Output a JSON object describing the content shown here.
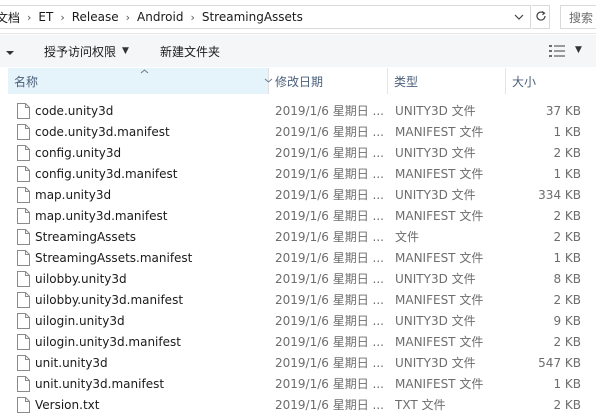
{
  "address_bar": {
    "crumbs": [
      "文档",
      "ET",
      "Release",
      "Android",
      "StreamingAssets"
    ],
    "separator": "›"
  },
  "search": {
    "placeholder": "搜索"
  },
  "toolbar": {
    "share_label": "授予访问权限",
    "new_folder_label": "新建文件夹"
  },
  "columns": {
    "name": "名称",
    "date": "修改日期",
    "type": "类型",
    "size": "大小"
  },
  "files": [
    {
      "name": "code.unity3d",
      "date": "2019/1/6 星期日 ...",
      "type": "UNITY3D 文件",
      "size": "37 KB"
    },
    {
      "name": "code.unity3d.manifest",
      "date": "2019/1/6 星期日 ...",
      "type": "MANIFEST 文件",
      "size": "1 KB"
    },
    {
      "name": "config.unity3d",
      "date": "2019/1/6 星期日 ...",
      "type": "UNITY3D 文件",
      "size": "2 KB"
    },
    {
      "name": "config.unity3d.manifest",
      "date": "2019/1/6 星期日 ...",
      "type": "MANIFEST 文件",
      "size": "1 KB"
    },
    {
      "name": "map.unity3d",
      "date": "2019/1/6 星期日 ...",
      "type": "UNITY3D 文件",
      "size": "334 KB"
    },
    {
      "name": "map.unity3d.manifest",
      "date": "2019/1/6 星期日 ...",
      "type": "MANIFEST 文件",
      "size": "2 KB"
    },
    {
      "name": "StreamingAssets",
      "date": "2019/1/6 星期日 ...",
      "type": "文件",
      "size": "2 KB"
    },
    {
      "name": "StreamingAssets.manifest",
      "date": "2019/1/6 星期日 ...",
      "type": "MANIFEST 文件",
      "size": "1 KB"
    },
    {
      "name": "uilobby.unity3d",
      "date": "2019/1/6 星期日 ...",
      "type": "UNITY3D 文件",
      "size": "8 KB"
    },
    {
      "name": "uilobby.unity3d.manifest",
      "date": "2019/1/6 星期日 ...",
      "type": "MANIFEST 文件",
      "size": "2 KB"
    },
    {
      "name": "uilogin.unity3d",
      "date": "2019/1/6 星期日 ...",
      "type": "UNITY3D 文件",
      "size": "9 KB"
    },
    {
      "name": "uilogin.unity3d.manifest",
      "date": "2019/1/6 星期日 ...",
      "type": "MANIFEST 文件",
      "size": "2 KB"
    },
    {
      "name": "unit.unity3d",
      "date": "2019/1/6 星期日 ...",
      "type": "UNITY3D 文件",
      "size": "547 KB"
    },
    {
      "name": "unit.unity3d.manifest",
      "date": "2019/1/6 星期日 ...",
      "type": "MANIFEST 文件",
      "size": "1 KB"
    },
    {
      "name": "Version.txt",
      "date": "2019/1/6 星期日 ...",
      "type": "TXT 文件",
      "size": "2 KB"
    }
  ]
}
